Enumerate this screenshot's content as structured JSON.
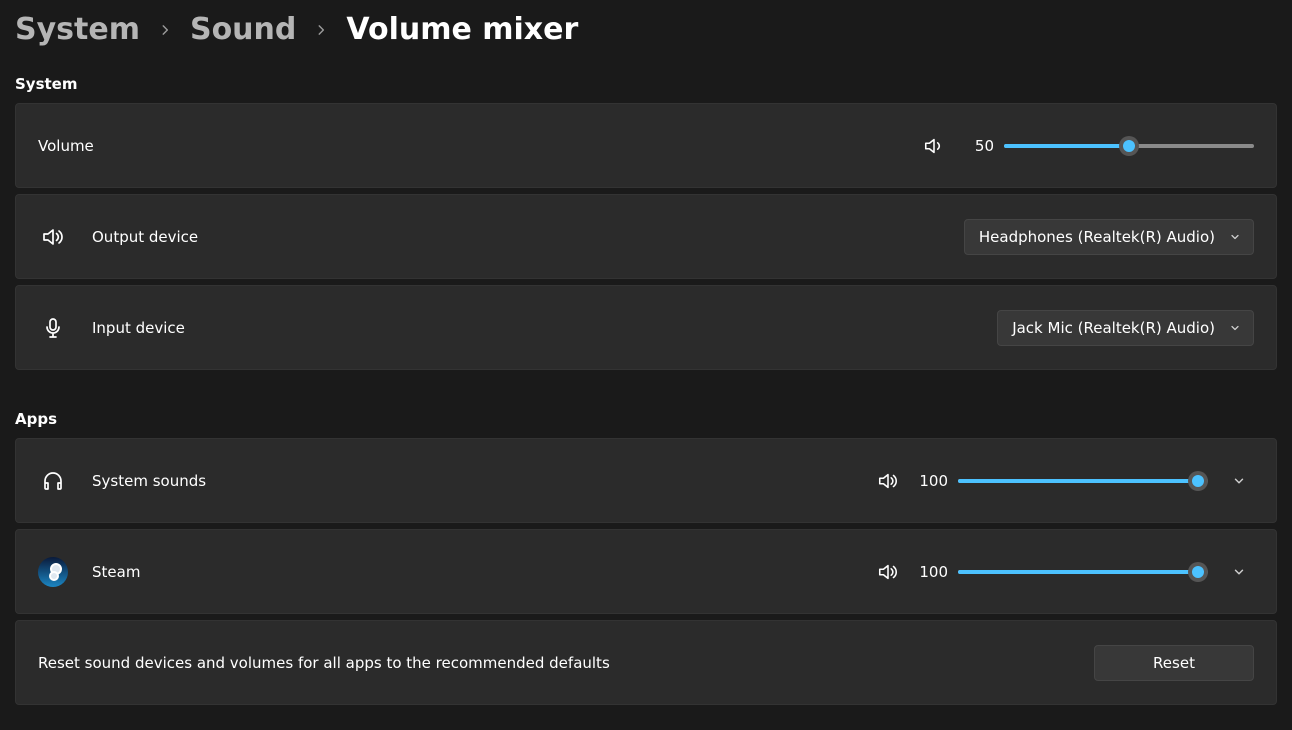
{
  "breadcrumb": {
    "system": "System",
    "sound": "Sound",
    "volume_mixer": "Volume mixer"
  },
  "sections": {
    "system_heading": "System",
    "apps_heading": "Apps"
  },
  "system": {
    "volume": {
      "label": "Volume",
      "value": "50",
      "percent": 50
    },
    "output": {
      "label": "Output device",
      "selected": "Headphones (Realtek(R) Audio)"
    },
    "input": {
      "label": "Input device",
      "selected": "Jack Mic (Realtek(R) Audio)"
    }
  },
  "apps": [
    {
      "id": "system-sounds",
      "label": "System sounds",
      "value": "100",
      "percent": 100,
      "icon": "headphones"
    },
    {
      "id": "steam",
      "label": "Steam",
      "value": "100",
      "percent": 100,
      "icon": "steam"
    }
  ],
  "reset": {
    "description": "Reset sound devices and volumes for all apps to the recommended defaults",
    "button": "Reset"
  }
}
